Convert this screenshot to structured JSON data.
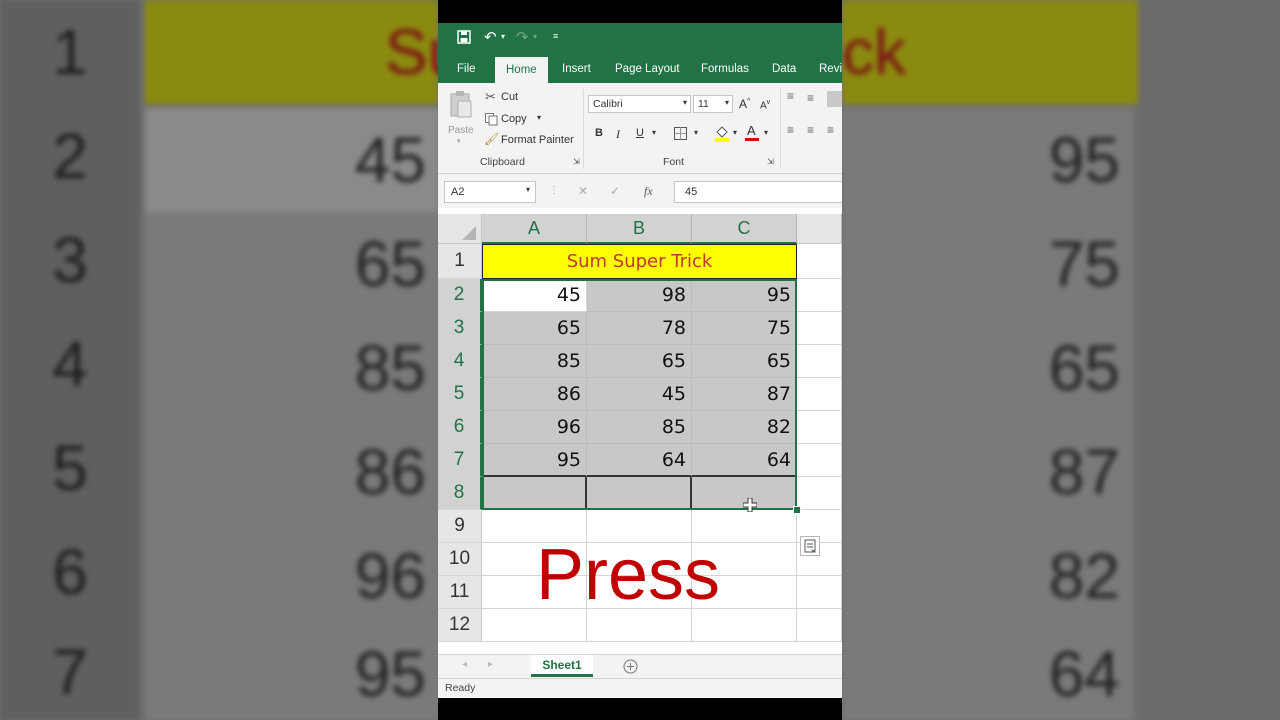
{
  "window": {
    "tabs": [
      {
        "label": "File"
      },
      {
        "label": "Home"
      },
      {
        "label": "Insert"
      },
      {
        "label": "Page Layout"
      },
      {
        "label": "Formulas"
      },
      {
        "label": "Data"
      },
      {
        "label": "Revi"
      }
    ],
    "active_tab": "Home"
  },
  "ribbon": {
    "paste_label": "Paste",
    "cut_label": "Cut",
    "copy_label": "Copy",
    "format_painter_label": "Format Painter",
    "clipboard_group": "Clipboard",
    "font_name": "Calibri",
    "font_size": "11",
    "bold": "B",
    "italic": "I",
    "underline": "U",
    "grow_font": "A",
    "shrink_font": "A",
    "font_color_letter": "A",
    "font_group": "Font"
  },
  "formula_bar": {
    "name_box": "A2",
    "cancel": "✕",
    "enter": "✓",
    "fx": "fx",
    "value": "45"
  },
  "sheet": {
    "columns": [
      "A",
      "B",
      "C"
    ],
    "row_numbers": [
      "1",
      "2",
      "3",
      "4",
      "5",
      "6",
      "7",
      "8",
      "9",
      "10",
      "11",
      "12"
    ],
    "title": "Sum Super Trick",
    "data": [
      [
        "45",
        "98",
        "95"
      ],
      [
        "65",
        "78",
        "75"
      ],
      [
        "85",
        "65",
        "65"
      ],
      [
        "86",
        "45",
        "87"
      ],
      [
        "96",
        "85",
        "82"
      ],
      [
        "95",
        "64",
        "64"
      ]
    ]
  },
  "overlay_text": "Press",
  "sheet_tabs": [
    "Sheet1"
  ],
  "status": "Ready",
  "background": {
    "row_numbers": [
      "1",
      "2",
      "3",
      "4",
      "5",
      "6",
      "7"
    ],
    "title_fragment_left": "Su",
    "title_fragment_right": "ck",
    "left_values": [
      "45",
      "65",
      "85",
      "86",
      "96",
      "95"
    ],
    "right_values": [
      "95",
      "75",
      "65",
      "87",
      "82",
      "64"
    ]
  },
  "colors": {
    "excel_green": "#217346",
    "title_fill": "#ffff00",
    "title_text": "#c0392b",
    "press_text": "#c00000"
  }
}
